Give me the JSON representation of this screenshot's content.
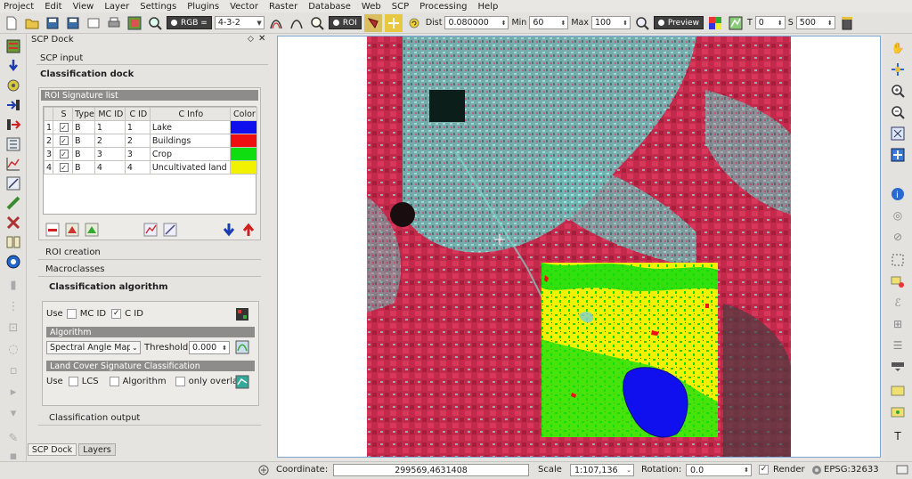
{
  "menu": [
    "Project",
    "Edit",
    "View",
    "Layer",
    "Settings",
    "Plugins",
    "Vector",
    "Raster",
    "Database",
    "Web",
    "SCP",
    "Processing",
    "Help"
  ],
  "toolbar": {
    "rgb_label": "RGB =",
    "rgb_value": "4-3-2",
    "roi_label": "ROI",
    "dist_label": "Dist",
    "dist_value": "0.080000",
    "min_label": "Min",
    "min_value": "60",
    "max_label": "Max",
    "max_value": "100",
    "preview_label": "Preview",
    "t_label": "T",
    "t_value": "0",
    "s_label": "S",
    "s_value": "500"
  },
  "dock": {
    "title": "SCP Dock",
    "scp_input": "SCP input",
    "classification_dock": "Classification dock",
    "roi_list_title": "ROI Signature list",
    "table": {
      "headers": [
        "",
        "S",
        "Type",
        "MC ID",
        "C ID",
        "C Info",
        "Color"
      ],
      "rows": [
        {
          "n": "1",
          "type": "B",
          "mc_id": "1",
          "c_id": "1",
          "info": "Lake",
          "color": "#1010ee"
        },
        {
          "n": "2",
          "type": "B",
          "mc_id": "2",
          "c_id": "2",
          "info": "Buildings",
          "color": "#ee1010"
        },
        {
          "n": "3",
          "type": "B",
          "mc_id": "3",
          "c_id": "3",
          "info": "Crop",
          "color": "#10dd10"
        },
        {
          "n": "4",
          "type": "B",
          "mc_id": "4",
          "c_id": "4",
          "info": "Uncultivated land",
          "color": "#f2f200"
        }
      ]
    },
    "roi_creation": "ROI creation",
    "macroclasses": "Macroclasses",
    "classification_algorithm": "Classification algorithm",
    "use_label": "Use",
    "mc_id_label": "MC ID",
    "c_id_label": "C ID",
    "algorithm_header": "Algorithm",
    "algorithm_value": "Spectral Angle Map",
    "threshold_label": "Threshold",
    "threshold_value": "0.000",
    "lcs_header": "Land Cover Signature Classification",
    "use2_label": "Use",
    "lcs_label": "LCS",
    "algorithm_label": "Algorithm",
    "only_overlap_label": "only overlap",
    "classification_output": "Classification output"
  },
  "bottom_tabs": [
    "SCP Dock",
    "Layers"
  ],
  "status": {
    "coordinate_label": "Coordinate:",
    "coordinate_value": "299569,4631408",
    "scale_label": "Scale",
    "scale_value": "1:107,136",
    "rotation_label": "Rotation:",
    "rotation_value": "0.0",
    "render_label": "Render",
    "epsg": "EPSG:32633"
  },
  "colors": {
    "lake": "#1010ee",
    "buildings": "#ee1010",
    "crop": "#10dd10",
    "uncultivated": "#f2f200",
    "vegetation_red": "#c8274a",
    "urban_cyan": "#5fcfc0"
  }
}
